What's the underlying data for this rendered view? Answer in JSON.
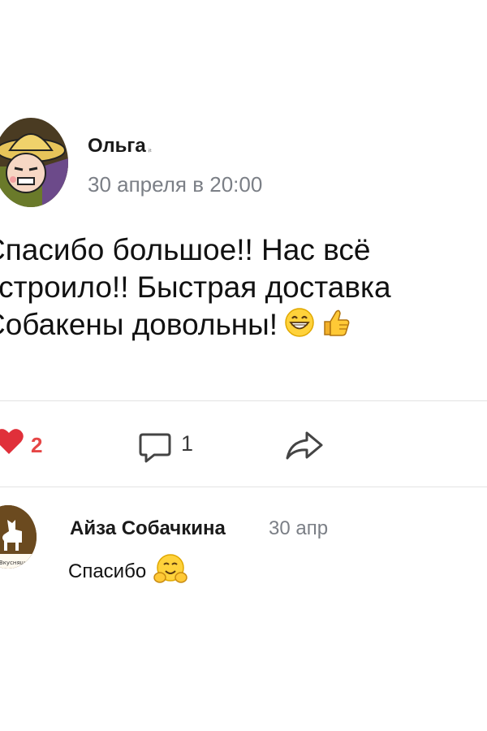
{
  "post": {
    "author": "Ольга",
    "author_badge": "ᵢₜ",
    "date": "30 апреля в 20:00",
    "text_lines": [
      "Спасибо большое!! Нас всё",
      "устроило!! Быстрая доставка",
      "Собакены довольны!"
    ],
    "emojis": [
      "grinning-face",
      "thumbs-up"
    ]
  },
  "actions": {
    "likes": "2",
    "comments": "1"
  },
  "comment": {
    "author": "Айза Собачкина",
    "date": "30 апр",
    "text": "Спасибо",
    "avatar_caption": "Вкусняш",
    "emoji": "hugging-face"
  },
  "colors": {
    "like": "#e0303a",
    "secondary_text": "#7b7f86",
    "divider": "#e3e3e3"
  }
}
